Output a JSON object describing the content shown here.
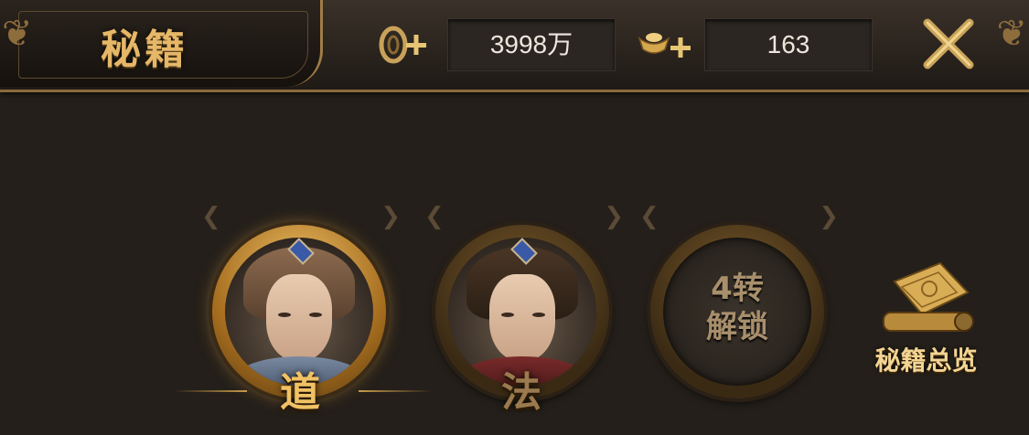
{
  "header": {
    "title": "秘籍",
    "coins": {
      "value": "3998万",
      "icon": "coin-plus-icon"
    },
    "ingots": {
      "value": "163",
      "icon": "gold-ingot-plus-icon"
    },
    "close_icon": "close-icon"
  },
  "characters": [
    {
      "label": "道",
      "state": "selected"
    },
    {
      "label": "法",
      "state": "unlocked"
    },
    {
      "label": "4转\n解锁",
      "state": "locked",
      "line1": "4转",
      "line2": "解锁"
    }
  ],
  "overview": {
    "label": "秘籍总览",
    "icon": "scroll-icon"
  },
  "colors": {
    "accent_gold": "#e5b767",
    "background": "#241f1a",
    "bar_border": "#8a6a3c"
  }
}
